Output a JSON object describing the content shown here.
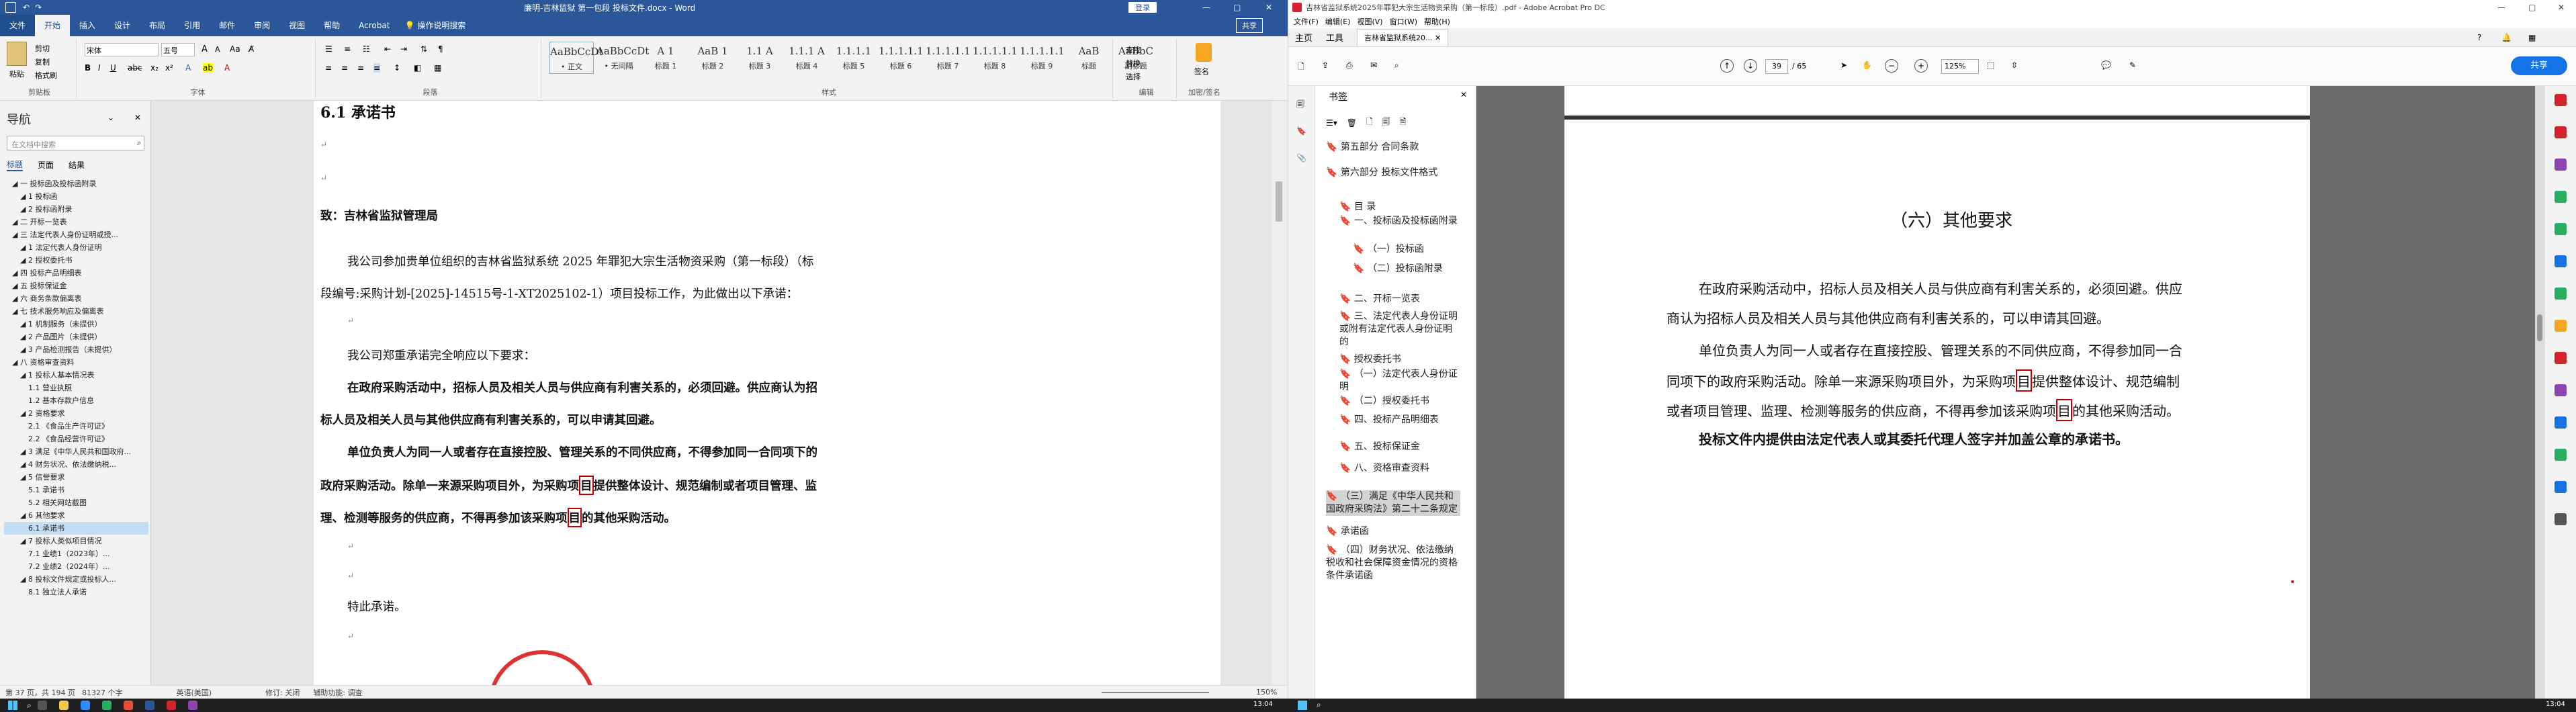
{
  "word": {
    "title": "廉明-吉林监狱 第一包段 投标文件.docx - Word",
    "share": "共享",
    "tabs": [
      "文件",
      "开始",
      "插入",
      "设计",
      "布局",
      "引用",
      "邮件",
      "审阅",
      "视图",
      "帮助",
      "Acrobat",
      "操作说明搜索"
    ],
    "active_tab": "开始",
    "ribbon": {
      "paste": "粘贴",
      "cut": "剪切",
      "copy": "复制",
      "painter": "格式刷",
      "clipboard": "剪贴板",
      "font_name": "宋体",
      "font_size": "五号",
      "font_group": "字体",
      "para_group": "段落",
      "styles": [
        {
          "sample": "AaBbCcDt",
          "label": "• 正文"
        },
        {
          "sample": "AaBbCcDt",
          "label": "• 无间隔"
        },
        {
          "sample": "A 1",
          "label": "标题 1"
        },
        {
          "sample": "AaB 1",
          "label": "标题 2"
        },
        {
          "sample": "1.1 A",
          "label": "标题 3"
        },
        {
          "sample": "1.1.1 A",
          "label": "标题 4"
        },
        {
          "sample": "1.1.1.1",
          "label": "标题 5"
        },
        {
          "sample": "1.1.1.1.1",
          "label": "标题 6"
        },
        {
          "sample": "1.1.1.1.1",
          "label": "标题 7"
        },
        {
          "sample": "1.1.1.1.1",
          "label": "标题 8"
        },
        {
          "sample": "1.1.1.1.1",
          "label": "标题 9"
        },
        {
          "sample": "AaB",
          "label": "标题"
        },
        {
          "sample": "AaBbC",
          "label": "副标题"
        }
      ],
      "style_group": "样式",
      "find": "查找",
      "replace": "替换",
      "select": "选择",
      "edit_group": "编辑",
      "sign": "签名",
      "sign_group": "加密/签名"
    },
    "nav": {
      "title": "导航",
      "search_placeholder": "在文档中搜索",
      "tabs": [
        "标题",
        "页面",
        "结果"
      ],
      "items": [
        "一 投标函及投标函附录",
        "1 投标函",
        "2 投标函附录",
        "二 开标一览表",
        "三 法定代表人身份证明或授...",
        "1 法定代表人身份证明",
        "2 授权委托书",
        "四 投标产品明细表",
        "五 投标保证金",
        "六 商务条款偏离表",
        "七 技术服务响应及偏离表",
        "1 机制服务（未提供）",
        "2 产品图片（未提供）",
        "3 产品检测报告（未提供）",
        "八 资格审查资料",
        "1 投标人基本情况表",
        "1.1 营业执照",
        "1.2 基本存款户信息",
        "2 资格要求",
        "2.1 《食品生产许可证》",
        "2.2 《食品经营许可证》",
        "3 满足《中华人民共和国政府...",
        "4 财务状况、依法缴纳税...",
        "5 信誉要求",
        "5.1 承诺书",
        "5.2 相关网站截图",
        "6 其他要求",
        "6.1 承诺书",
        "7 投标人类似项目情况",
        "7.1 业绩1（2023年）...",
        "7.2 业绩2（2024年）...",
        "8 投标文件规定或投标人...",
        "8.1 独立法人承诺"
      ],
      "selected_index": 27
    },
    "doc": {
      "heading": "6.1 承诺书",
      "to": "致：吉林省监狱管理局",
      "p1a": "我公司参加贵单位组织的吉林省监狱系统 2025 年罪犯大宗生活物资采购（第一标段）（标",
      "p1b": "段编号:采购计划-[2025]-14515号-1-XT2025102-1）项目投标工作，为此做出以下承诺：",
      "p2": "我公司郑重承诺完全响应以下要求：",
      "p3a": "在政府采购活动中，招标人员及相关人员与供应商有利害关系的，必须回避。供应商认为招",
      "p3b": "标人员及相关人员与其他供应商有利害关系的，可以申请其回避。",
      "p4a": "单位负责人为同一人或者存在直接控股、管理关系的不同供应商，不得参加同一合同项下的",
      "p4b_1": "政府采购活动。除单一来源采购项目外，为采购项",
      "p4b_box": "目",
      "p4b_2": "提供整体设计、规范编制或者项目管理、监",
      "p4c_1": "理、检测等服务的供应商，不得再参加该采购项",
      "p4c_box": "目",
      "p4c_2": "的其他采购活动。",
      "closing": "特此承诺。"
    },
    "status": {
      "page": "第 37 页，共 194 页",
      "words": "81327 个字",
      "lang": "英语(美国)",
      "track": "修订: 关闭",
      "access": "辅助功能: 调查",
      "zoom": "150%"
    }
  },
  "acrobat": {
    "title": "吉林省监狱系统2025年罪犯大宗生活物资采购（第一标段）.pdf - Adobe Acrobat Pro DC",
    "menu": [
      "文件(F)",
      "编辑(E)",
      "视图(V)",
      "窗口(W)",
      "帮助(H)"
    ],
    "tabs": [
      "主页",
      "工具",
      "吉林省监狱系统20..."
    ],
    "page_current": "39",
    "page_total": "/ 65",
    "zoom": "125%",
    "share": "共享",
    "bookmarks_title": "书签",
    "bookmarks": [
      "第五部分 合同条款",
      "第六部分 投标文件格式",
      "目 录",
      "一、投标函及投标函附录",
      "（一）投标函",
      "（二）投标函附录",
      "二、开标一览表",
      "三、法定代表人身份证明或附有法定代表人身份证明的",
      "授权委托书",
      "（一）法定代表人身份证明",
      "（二）授权委托书",
      "四、投标产品明细表",
      "五、投标保证金",
      "八、资格审查资料",
      "（三）满足《中华人民共和国政府采购法》第二十二条规定",
      "承诺函",
      "（四）财务状况、依法缴纳税收和社会保障资金情况的资格条件承诺函"
    ],
    "bookmark_selected": 14,
    "pdf": {
      "heading": "（六）其他要求",
      "l1": "在政府采购活动中，招标人员及相关人员与供应商有利害关系的，必须回避。供应",
      "l2": "商认为招标人员及相关人员与其他供应商有利害关系的，可以申请其回避。",
      "l3": "单位负责人为同一人或者存在直接控股、管理关系的不同供应商，不得参加同一合",
      "l4_1": "同项下的政府采购活动。除单一来源采购项目外，为采购项",
      "l4_box": "目",
      "l4_2": "提供整体设计、规范编制",
      "l5_1": "或者项目管理、监理、检测等服务的供应商，不得再参加该采购项",
      "l5_box": "目",
      "l5_2": "的其他采购活动。",
      "l6": "投标文件内提供由法定代表人或其委托代理人签字并加盖公章的承诺书。"
    }
  },
  "taskbar": {
    "time_left": "13:04",
    "time_right": "13:04"
  }
}
